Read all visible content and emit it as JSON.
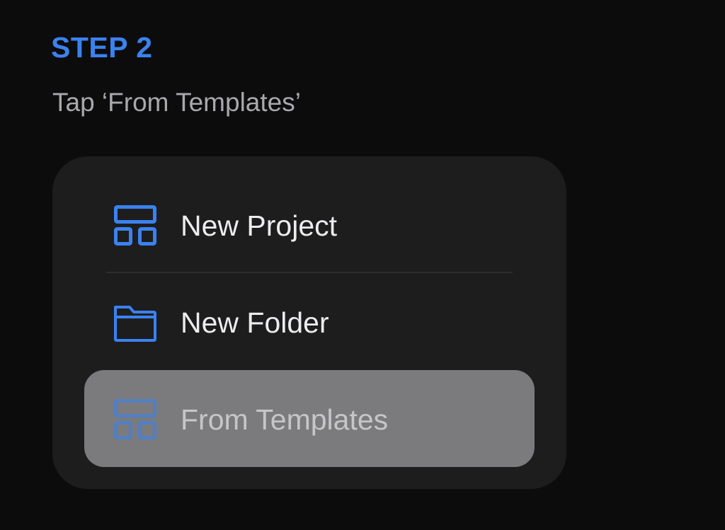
{
  "step": {
    "label": "STEP 2",
    "instruction": "Tap ‘From Templates’"
  },
  "menu": {
    "items": [
      {
        "label": "New Project",
        "icon": "layout-template-icon"
      },
      {
        "label": "New Folder",
        "icon": "folder-icon"
      },
      {
        "label": "From Templates",
        "icon": "layout-template-icon",
        "highlighted": true
      }
    ]
  },
  "colors": {
    "background": "#0c0c0d",
    "card": "#1d1d1e",
    "accent": "#3a82f0",
    "highlight": "#7b7b7d",
    "item_text": "#ececef",
    "instruction_text": "#a8a8ad"
  }
}
